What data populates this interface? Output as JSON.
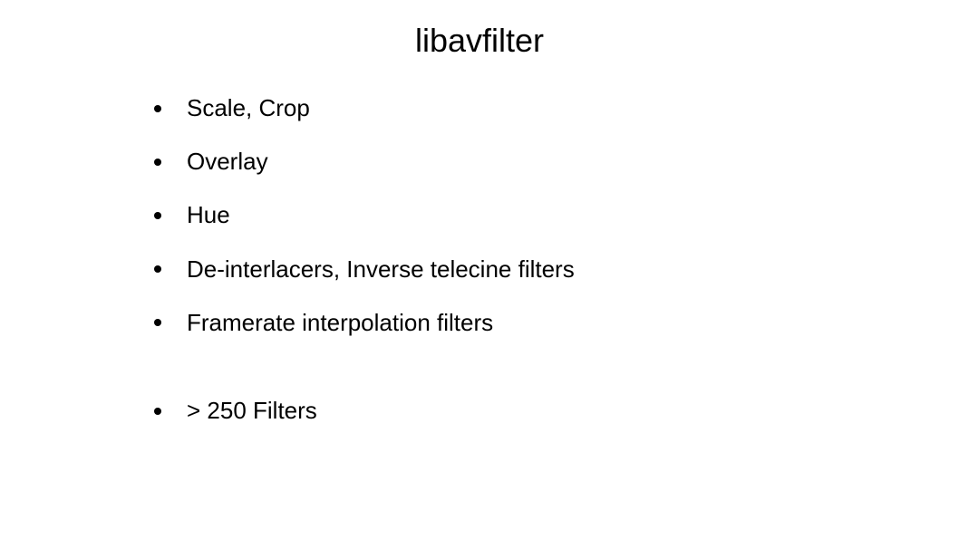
{
  "slide": {
    "title": "libavfilter",
    "bullets_group1": [
      "Scale, Crop",
      "Overlay",
      "Hue",
      "De-interlacers, Inverse telecine filters",
      "Framerate interpolation filters"
    ],
    "bullets_group2": [
      "> 250 Filters"
    ]
  }
}
